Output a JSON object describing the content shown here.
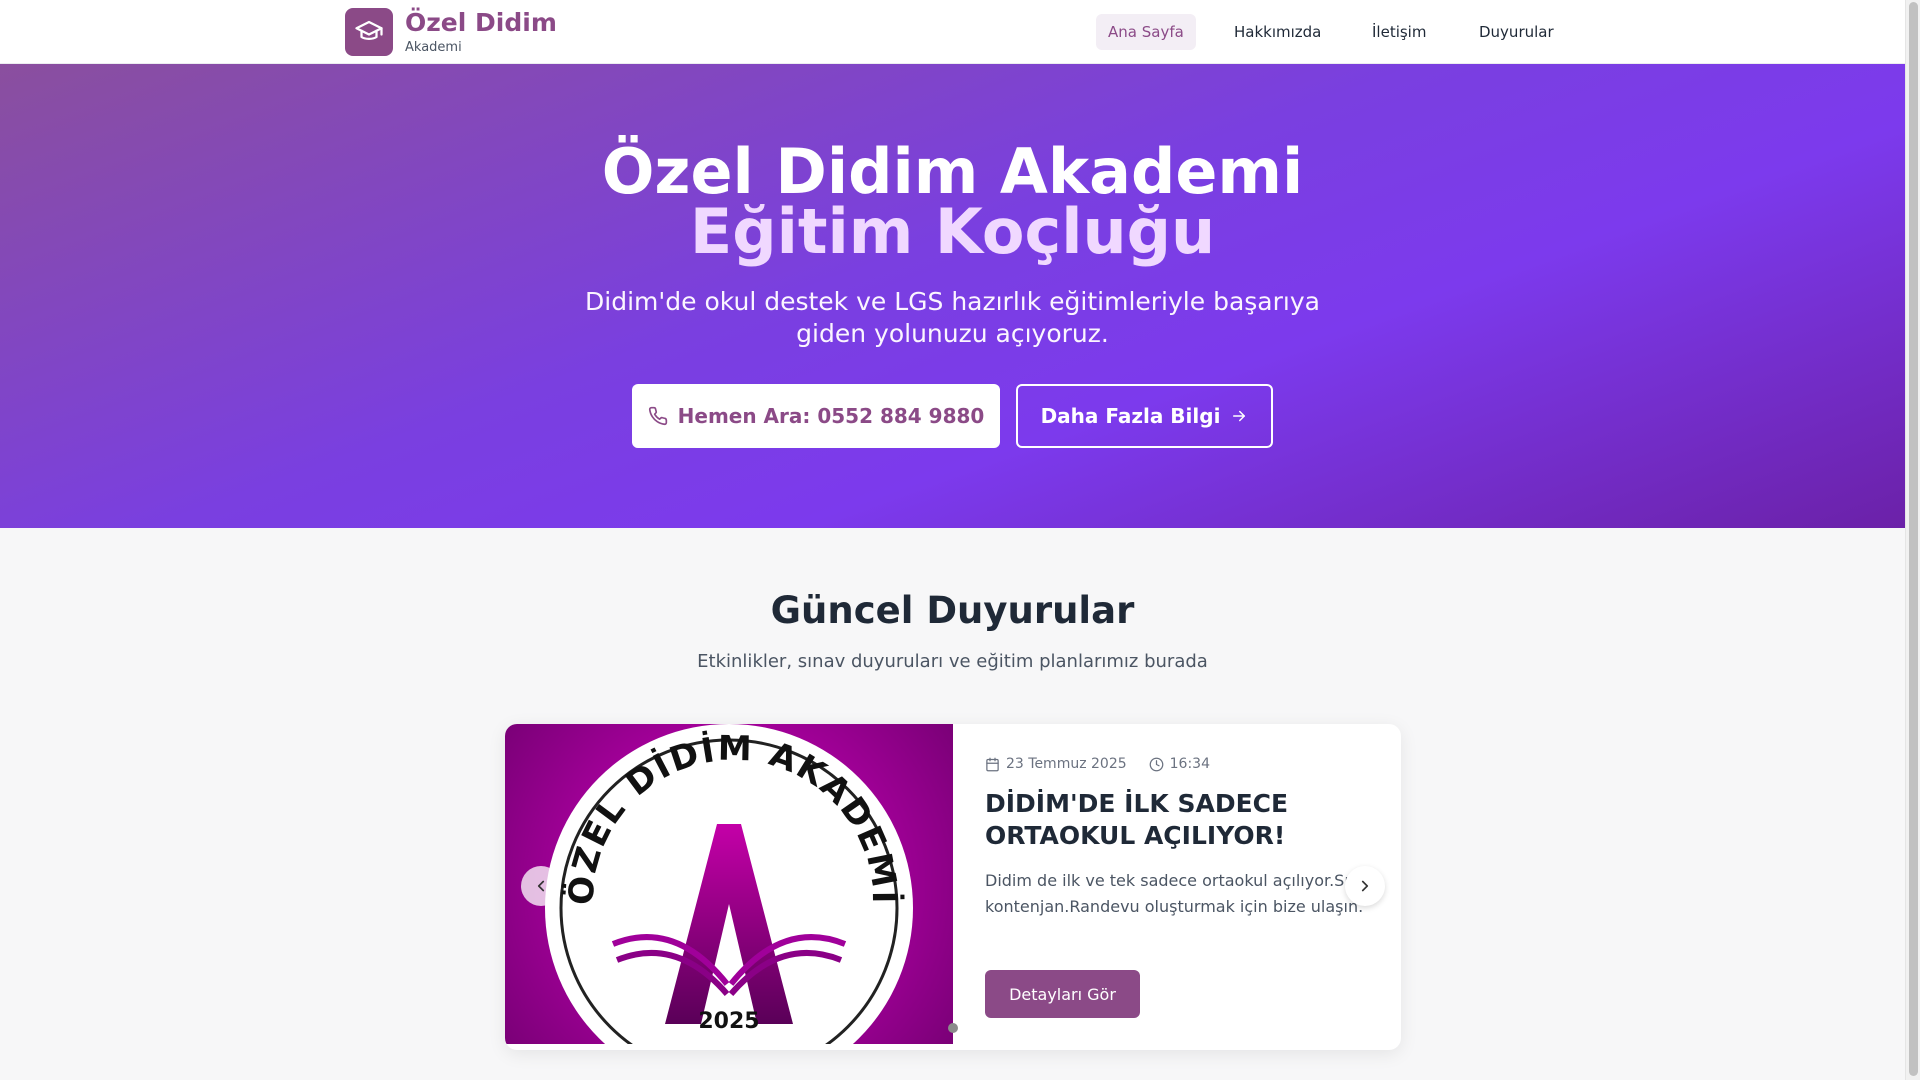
{
  "brand": {
    "title": "Özel Didim",
    "subtitle": "Akademi",
    "icon": "graduation-cap-icon"
  },
  "nav": {
    "items": [
      {
        "label": "Ana Sayfa",
        "active": true
      },
      {
        "label": "Hakkımızda",
        "active": false
      },
      {
        "label": "İletişim",
        "active": false
      },
      {
        "label": "Duyurular",
        "active": false
      }
    ]
  },
  "hero": {
    "title_line1": "Özel Didim Akademi",
    "title_line2": "Eğitim Koçluğu",
    "subtitle": "Didim'de okul destek ve LGS hazırlık eğitimleriyle başarıya giden yolunuzu açıyoruz.",
    "call_button": "Hemen Ara: 0552 884 9880",
    "more_button": "Daha Fazla Bilgi"
  },
  "announcements": {
    "title": "Güncel Duyurular",
    "subtitle": "Etkinlikler, sınav duyuruları ve eğitim planlarımız burada",
    "items": [
      {
        "date": "23 Temmuz 2025",
        "time": "16:34",
        "title": "DİDİM'DE İLK SADECE ORTAOKUL AÇILIYOR!",
        "description": "Didim de ilk ve tek sadece ortaokul açılıyor.Sınırlı kontenjan.Randevu oluşturmak için bize ulaşın.",
        "button": "Detayları Gör",
        "image": {
          "arc_text": "ÖZEL DİDİM AKADEMİ",
          "year": "2025"
        }
      }
    ]
  },
  "colors": {
    "brand": "#8b4a87",
    "hero_start": "#8a4f9e",
    "hero_end": "#6b21a8",
    "image_magenta": "#b000a4"
  }
}
